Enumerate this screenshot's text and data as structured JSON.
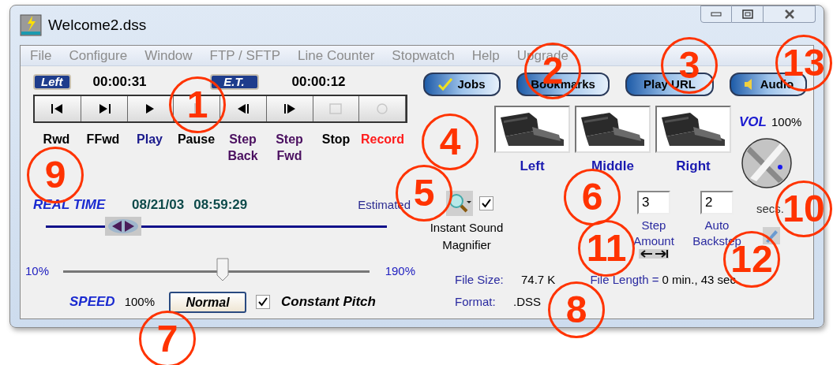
{
  "window": {
    "title": "Welcome2.dss"
  },
  "menu": [
    {
      "label": "File"
    },
    {
      "label": "Configure"
    },
    {
      "label": "Window"
    },
    {
      "label": "FTP / SFTP"
    },
    {
      "label": "Line Counter"
    },
    {
      "label": "Stopwatch"
    },
    {
      "label": "Help"
    },
    {
      "label": "Upgrade"
    }
  ],
  "counters": [
    {
      "badge": "Left",
      "time": "00:00:31"
    },
    {
      "badge": "E.T.",
      "time": "00:00:12"
    }
  ],
  "transport": [
    {
      "kind": "rewind",
      "label": "Rwd",
      "color": "#000000",
      "disabled": false
    },
    {
      "kind": "forward",
      "label": "FFwd",
      "color": "#000000",
      "disabled": false
    },
    {
      "kind": "play",
      "label": "Play",
      "color": "#1a1a8c",
      "disabled": false
    },
    {
      "kind": "pause",
      "label": "Pause",
      "color": "#000000",
      "disabled": true
    },
    {
      "kind": "step_back",
      "label": "Step Back",
      "color": "#4b1060",
      "disabled": false
    },
    {
      "kind": "step_forward",
      "label": "Step Fwd",
      "color": "#4b1060",
      "disabled": false
    },
    {
      "kind": "stop",
      "label": "Stop",
      "color": "#000000",
      "disabled": true
    },
    {
      "kind": "record",
      "label": "Record",
      "color": "#ff1a1a",
      "disabled": true
    }
  ],
  "toolbar_buttons": [
    {
      "kind": "check",
      "label": "Jobs"
    },
    {
      "kind": "plain",
      "label": "Bookmarks"
    },
    {
      "kind": "plain",
      "label": "Play URL"
    },
    {
      "kind": "speaker",
      "label": "Audio"
    }
  ],
  "pedals": [
    {
      "label": "Left"
    },
    {
      "label": "Middle"
    },
    {
      "label": "Right"
    }
  ],
  "volume": {
    "label": "VOL",
    "value": "100%"
  },
  "real_time": {
    "label": "REAL TIME",
    "date": "08/21/03",
    "time": "08:59:29",
    "note": "Estimated"
  },
  "position_slider": {
    "level": 0.23
  },
  "magnifier": {
    "checked": true,
    "label": "Instant Sound Magnifier"
  },
  "step_amount": {
    "value": "3",
    "label": "Step Amount"
  },
  "auto_backstep": {
    "value": "2",
    "label": "Auto Backstep",
    "unit": "secs."
  },
  "speed": {
    "min": "10%",
    "max": "190%",
    "level": 0.52,
    "label": "SPEED",
    "value": "100%",
    "button": "Normal"
  },
  "constant_pitch": {
    "checked": true,
    "label": "Constant Pitch"
  },
  "file_info": {
    "size_label": "File Size:",
    "size": "74.7 K",
    "format_label": "Format:",
    "format": ".DSS",
    "length_label": "File Length =",
    "length": "0 min., 43 sec."
  },
  "callouts": [
    {
      "number": "1"
    },
    {
      "number": "2"
    },
    {
      "number": "3"
    },
    {
      "number": "4"
    },
    {
      "number": "5"
    },
    {
      "number": "6"
    },
    {
      "number": "7"
    },
    {
      "number": "8"
    },
    {
      "number": "9"
    },
    {
      "number": "10"
    },
    {
      "number": "11"
    },
    {
      "number": "12"
    },
    {
      "number": "13"
    }
  ]
}
